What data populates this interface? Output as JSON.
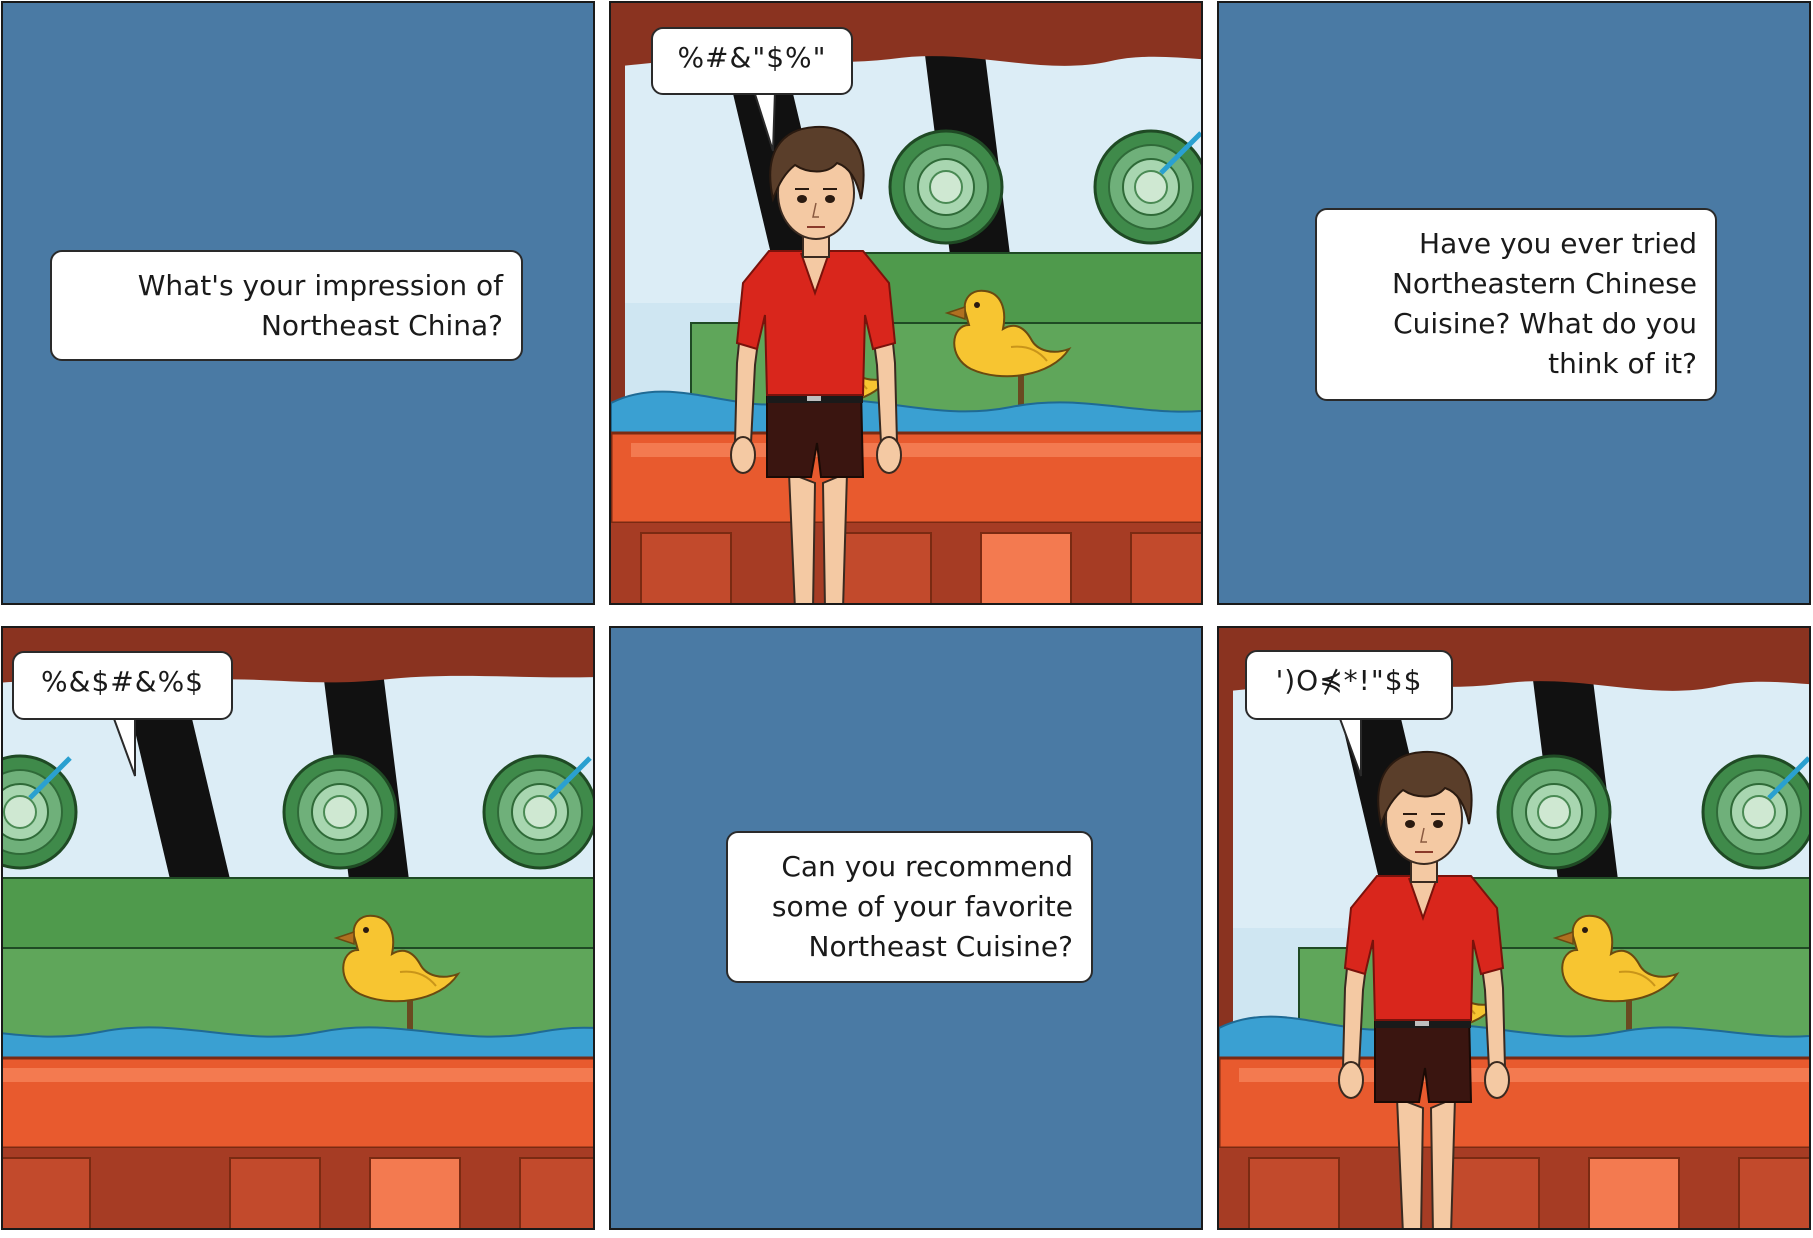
{
  "panels": [
    {
      "id": 1,
      "kind": "narration",
      "text_lines": [
        "What's your impression of",
        "Northeast China?"
      ]
    },
    {
      "id": 2,
      "kind": "scene",
      "speech": "%#&\"$%\""
    },
    {
      "id": 3,
      "kind": "narration",
      "text_lines": [
        "Have you ever tried",
        "Northeastern Chinese",
        "Cuisine? What do you",
        "think of it?"
      ]
    },
    {
      "id": 4,
      "kind": "scene",
      "speech": "%&$#&%$"
    },
    {
      "id": 5,
      "kind": "narration",
      "text_lines": [
        "Can you recommend",
        "some of your favorite",
        "Northeast Cuisine?"
      ]
    },
    {
      "id": 6,
      "kind": "scene",
      "speech": "')O⋠*!\"$$"
    }
  ],
  "colors": {
    "panel_blue": "#4a7aa4",
    "sky": "#cfe6f2",
    "frame_dark": "#111111",
    "wall_brown": "#8a3320",
    "boat_orange": "#e85a2e",
    "water_blue": "#3aa0d2",
    "grass_green": "#5fa65a",
    "duck_yellow": "#f7c531",
    "shirt_red": "#d9261c",
    "shorts_brown": "#3a1510"
  }
}
